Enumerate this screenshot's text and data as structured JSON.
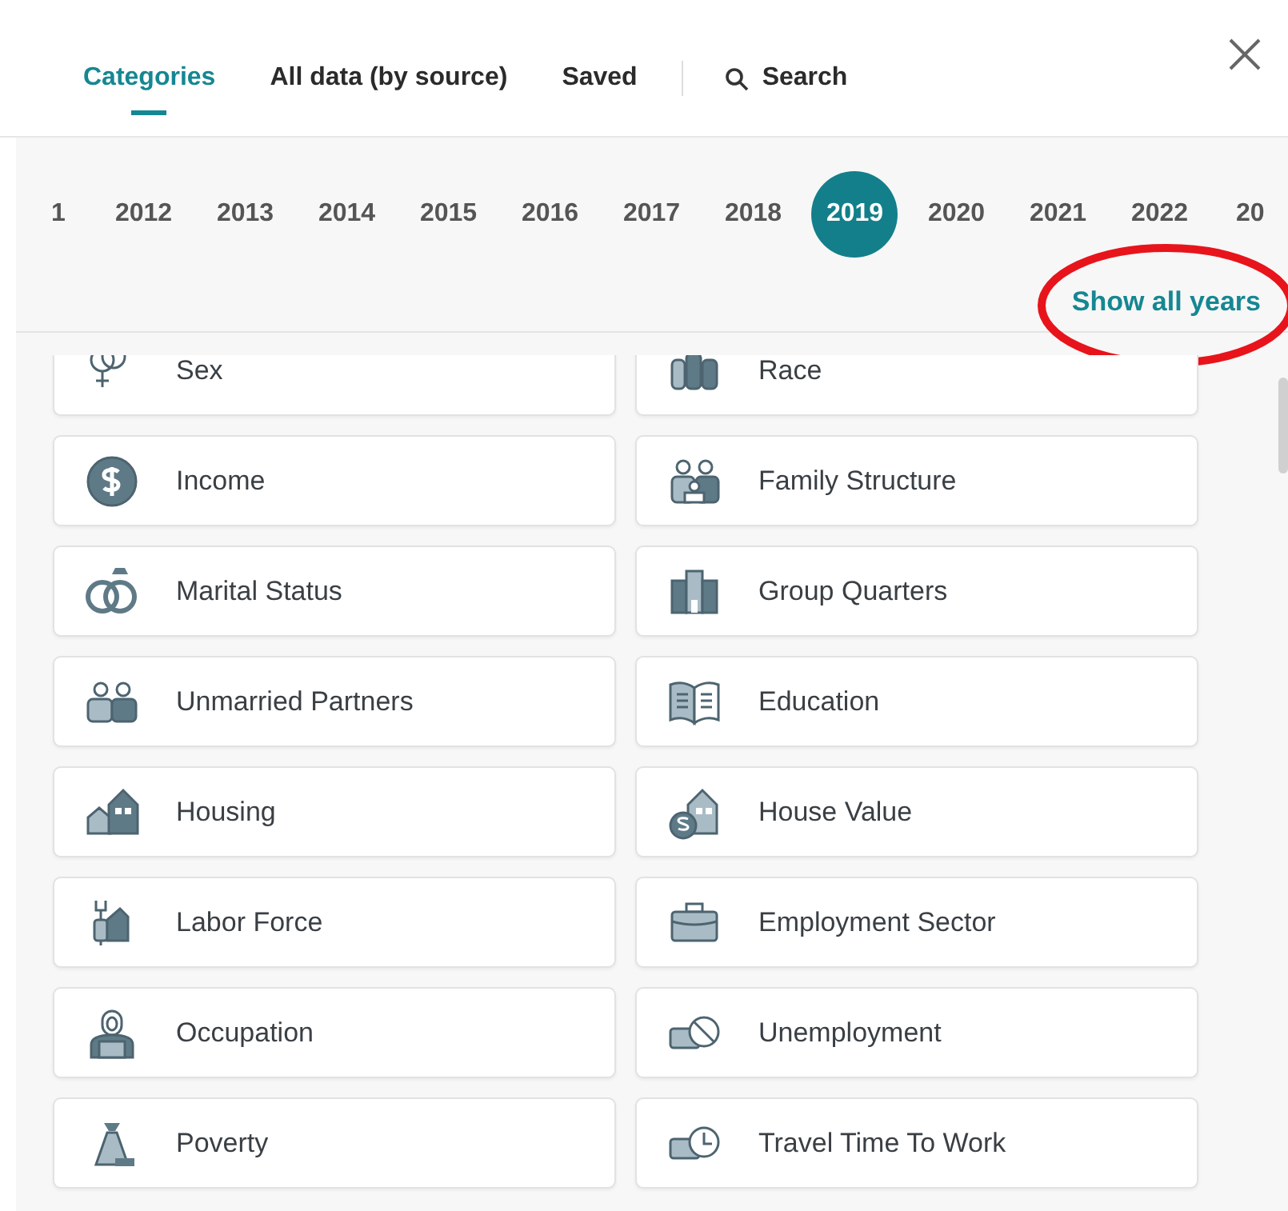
{
  "tabs": [
    {
      "label": "Categories",
      "selected": true
    },
    {
      "label": "All data (by source)",
      "selected": false
    },
    {
      "label": "Saved",
      "selected": false
    }
  ],
  "search": {
    "label": "Search"
  },
  "years": [
    {
      "label": "1",
      "selected": false
    },
    {
      "label": "2012",
      "selected": false
    },
    {
      "label": "2013",
      "selected": false
    },
    {
      "label": "2014",
      "selected": false
    },
    {
      "label": "2015",
      "selected": false
    },
    {
      "label": "2016",
      "selected": false
    },
    {
      "label": "2017",
      "selected": false
    },
    {
      "label": "2018",
      "selected": false
    },
    {
      "label": "2019",
      "selected": true
    },
    {
      "label": "2020",
      "selected": false
    },
    {
      "label": "2021",
      "selected": false
    },
    {
      "label": "2022",
      "selected": false
    },
    {
      "label": "20",
      "selected": false
    }
  ],
  "show_all_years": "Show all years",
  "categories": [
    "Sex",
    "Race",
    "Income",
    "Family Structure",
    "Marital Status",
    "Group Quarters",
    "Unmarried Partners",
    "Education",
    "Housing",
    "House Value",
    "Labor Force",
    "Employment Sector",
    "Occupation",
    "Unemployment",
    "Poverty",
    "Travel Time To Work"
  ]
}
